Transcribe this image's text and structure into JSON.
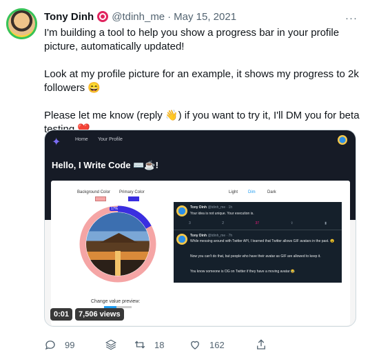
{
  "tweet": {
    "author_name": "Tony Dinh",
    "handle": "@tdinh_me",
    "separator": "·",
    "date": "May 15, 2021",
    "more": "···",
    "paragraphs": [
      "I'm building a tool to help you show a progress bar in your profile picture, automatically updated!",
      "Look at my profile picture for an example, it shows my progress to 2k followers 😄",
      "Please let me know (reply 👋) if you want to try it, I'll DM you for beta testing ❤️"
    ]
  },
  "video": {
    "nav_home": "Home",
    "nav_profile": "Your Profile",
    "headline": "Hello, I Write Code ⌨️☕!",
    "background_color_label": "Background Color",
    "primary_color_label": "Primary Color",
    "tab_light": "Light",
    "tab_dim": "Dim",
    "tab_dark": "Dark",
    "progress_percent": "17%",
    "progress_value": 0.17,
    "preview_label": "Change value preview:",
    "dark_tweet_1_name": "Tony Dinh",
    "dark_tweet_1_handle": "@tdinh_me · 1h",
    "dark_tweet_1_text": "Your idea is not unique. Your execution is.",
    "dark_tweet_1_reply": "3",
    "dark_tweet_1_retweet": "2",
    "dark_tweet_1_like": "37",
    "dark_tweet_2_name": "Tony Dinh",
    "dark_tweet_2_handle": "@tdinh_me · 7h",
    "dark_tweet_2_text_a": "While messing around with Twitter API, I learned that Twitter allows GIF avatars in the past. 😮",
    "dark_tweet_2_text_b": "Now you can't do that, but people who have their avatar as GIF are allowed to keep it.",
    "dark_tweet_2_text_c": "You know someone is OG on Twitter if they have a moving avatar 😂",
    "timestamp": "0:01",
    "views": "7,506 views",
    "colors": {
      "background": "#f5a5a5",
      "primary": "#3a2ee0"
    }
  },
  "actions": {
    "reply_count": "99",
    "retweet_count": "18",
    "like_count": "162"
  }
}
